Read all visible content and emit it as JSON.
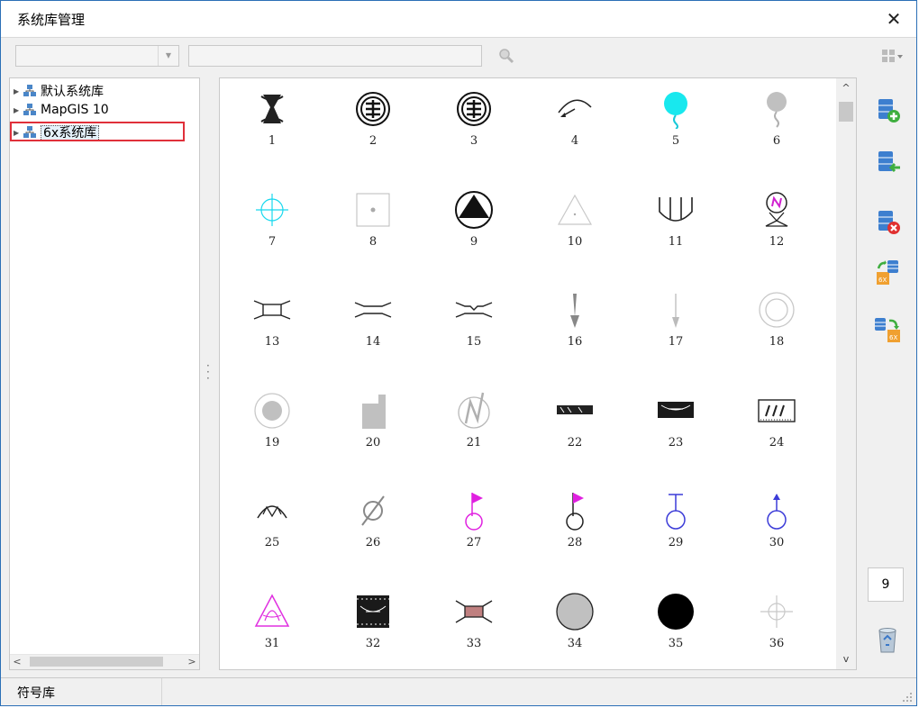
{
  "window": {
    "title": "系统库管理"
  },
  "toolbar": {
    "combo_value": "",
    "search_value": ""
  },
  "tree": {
    "items": [
      {
        "label": "默认系统库"
      },
      {
        "label": "MapGIS 10"
      },
      {
        "label": "6x系统库"
      }
    ]
  },
  "symbols": [
    "1",
    "2",
    "3",
    "4",
    "5",
    "6",
    "7",
    "8",
    "9",
    "10",
    "11",
    "12",
    "13",
    "14",
    "15",
    "16",
    "17",
    "18",
    "19",
    "20",
    "21",
    "22",
    "23",
    "24",
    "25",
    "26",
    "27",
    "28",
    "29",
    "30",
    "31",
    "32",
    "33",
    "34",
    "35",
    "36"
  ],
  "side": {
    "count": "9"
  },
  "status": {
    "text": "符号库"
  },
  "colors": {
    "accent": "#2b6fb6",
    "highlight": "#e0303a"
  }
}
